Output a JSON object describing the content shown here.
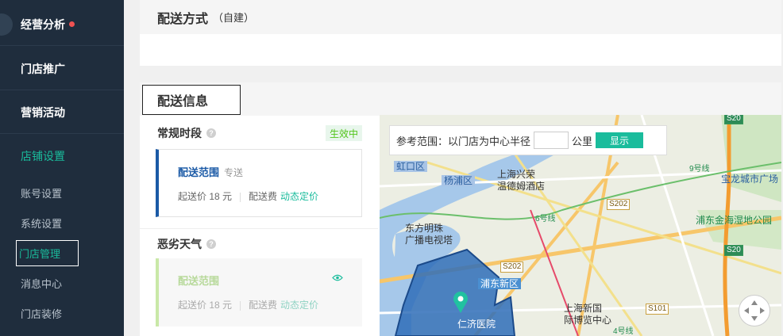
{
  "sidebar": {
    "items": [
      {
        "label": "经营分析"
      },
      {
        "label": "门店推广"
      },
      {
        "label": "营销活动"
      }
    ],
    "section": "店铺设置",
    "sub_items": [
      {
        "label": "账号设置"
      },
      {
        "label": "系统设置"
      },
      {
        "label": "门店管理"
      },
      {
        "label": "消息中心"
      },
      {
        "label": "门店装修"
      }
    ]
  },
  "delivery_method": {
    "title": "配送方式",
    "subtitle": "（自建）"
  },
  "delivery_info": {
    "title": "配送信息",
    "regular": {
      "title": "常规时段",
      "status": "生效中",
      "range_label": "配送范围",
      "range_tag": "专送",
      "min_price": "起送价 18 元",
      "fee_label": "配送费",
      "fee_link": "动态定价"
    },
    "bad_weather": {
      "title": "恶劣天气",
      "range_label": "配送范围",
      "min_price": "起送价 18 元",
      "fee_label": "配送费",
      "fee_link": "动态定价"
    }
  },
  "map": {
    "ref_label": "参考范围：以门店为中心半径",
    "radius_value": "",
    "unit": "公里",
    "show_button": "显示",
    "labels": {
      "hongkou": "虹口区",
      "yangpu": "杨浦区",
      "hotel_line1": "上海兴荣",
      "hotel_line2": "温德姆酒店",
      "pearl_line1": "东方明珠",
      "pearl_line2": "广播电视塔",
      "pudong": "浦东新区",
      "hospital": "仁济医院",
      "expo_line1": "上海新国",
      "expo_line2": "际博览中心",
      "baolong": "宝龙城市广场",
      "wetland": "浦东金海湿地公园",
      "s202_1": "S202",
      "s202_2": "S202",
      "s20_1": "S20",
      "s20_2": "S20",
      "s101": "S101",
      "line9": "9号线",
      "line6": "6号线",
      "line4": "4号线"
    }
  },
  "colors": {
    "sidebar_bg": "#1f2d3d",
    "accent": "#1abc9c",
    "primary_blue": "#1b5aa6"
  }
}
